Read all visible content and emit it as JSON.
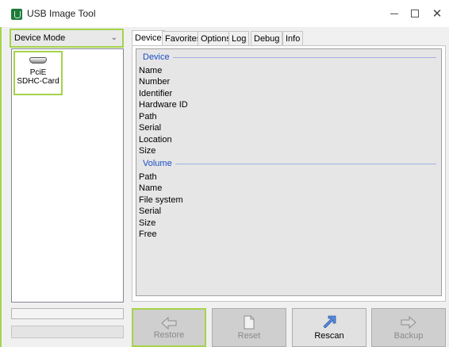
{
  "window": {
    "title": "USB Image Tool"
  },
  "sidebar": {
    "mode_value": "Device Mode",
    "devices": [
      {
        "label_line1": "PciE",
        "label_line2": "SDHC-Card"
      }
    ]
  },
  "tabs": [
    {
      "label": "Device",
      "active": true
    },
    {
      "label": "Favorites",
      "active": false
    },
    {
      "label": "Options",
      "active": false
    },
    {
      "label": "Log",
      "active": false
    },
    {
      "label": "Debug",
      "active": false
    },
    {
      "label": "Info",
      "active": false
    }
  ],
  "device_group": {
    "title": "Device",
    "fields": [
      "Name",
      "Number",
      "Identifier",
      "Hardware ID",
      "Path",
      "Serial",
      "Location",
      "Size"
    ]
  },
  "volume_group": {
    "title": "Volume",
    "fields": [
      "Path",
      "Name",
      "File system",
      "Serial",
      "Size",
      "Free"
    ]
  },
  "buttons": {
    "restore": "Restore",
    "reset": "Reset",
    "rescan": "Rescan",
    "backup": "Backup"
  },
  "colors": {
    "highlight": "#a6d34a",
    "group_title": "#1a4dc6"
  }
}
